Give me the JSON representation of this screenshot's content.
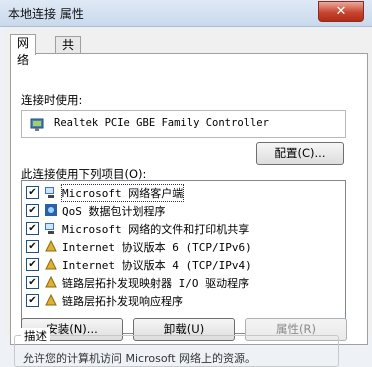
{
  "window": {
    "title": "本地连接 属性",
    "close_label": "✕"
  },
  "tabs": [
    {
      "label": "网络",
      "active": true
    },
    {
      "label": "共享",
      "active": false
    }
  ],
  "connect_using": {
    "label": "连接时使用:",
    "adapter": "Realtek PCIe GBE Family Controller",
    "configure_button": "配置(C)..."
  },
  "items_section": {
    "label": "此连接使用下列项目(O):",
    "items": [
      {
        "label": "Microsoft 网络客户端",
        "checked": true,
        "icon": "network-client-icon",
        "selected": true
      },
      {
        "label": "QoS 数据包计划程序",
        "checked": true,
        "icon": "service-icon",
        "selected": false
      },
      {
        "label": "Microsoft 网络的文件和打印机共享",
        "checked": true,
        "icon": "network-client-icon",
        "selected": false
      },
      {
        "label": "Internet 协议版本 6 (TCP/IPv6)",
        "checked": true,
        "icon": "protocol-icon",
        "selected": false
      },
      {
        "label": "Internet 协议版本 4 (TCP/IPv4)",
        "checked": true,
        "icon": "protocol-icon",
        "selected": false
      },
      {
        "label": "链路层拓扑发现映射器 I/O 驱动程序",
        "checked": true,
        "icon": "protocol-icon",
        "selected": false
      },
      {
        "label": "链路层拓扑发现响应程序",
        "checked": true,
        "icon": "protocol-icon",
        "selected": false
      }
    ]
  },
  "buttons": {
    "install": "安装(N)...",
    "uninstall": "卸载(U)",
    "properties": "属性(R)"
  },
  "description": {
    "legend": "描述",
    "text": "允许您的计算机访问 Microsoft 网络上的资源。"
  },
  "colors": {
    "close_button": "#c7452f",
    "titlebar": "#c9d9ec",
    "check": "#1c5180"
  }
}
